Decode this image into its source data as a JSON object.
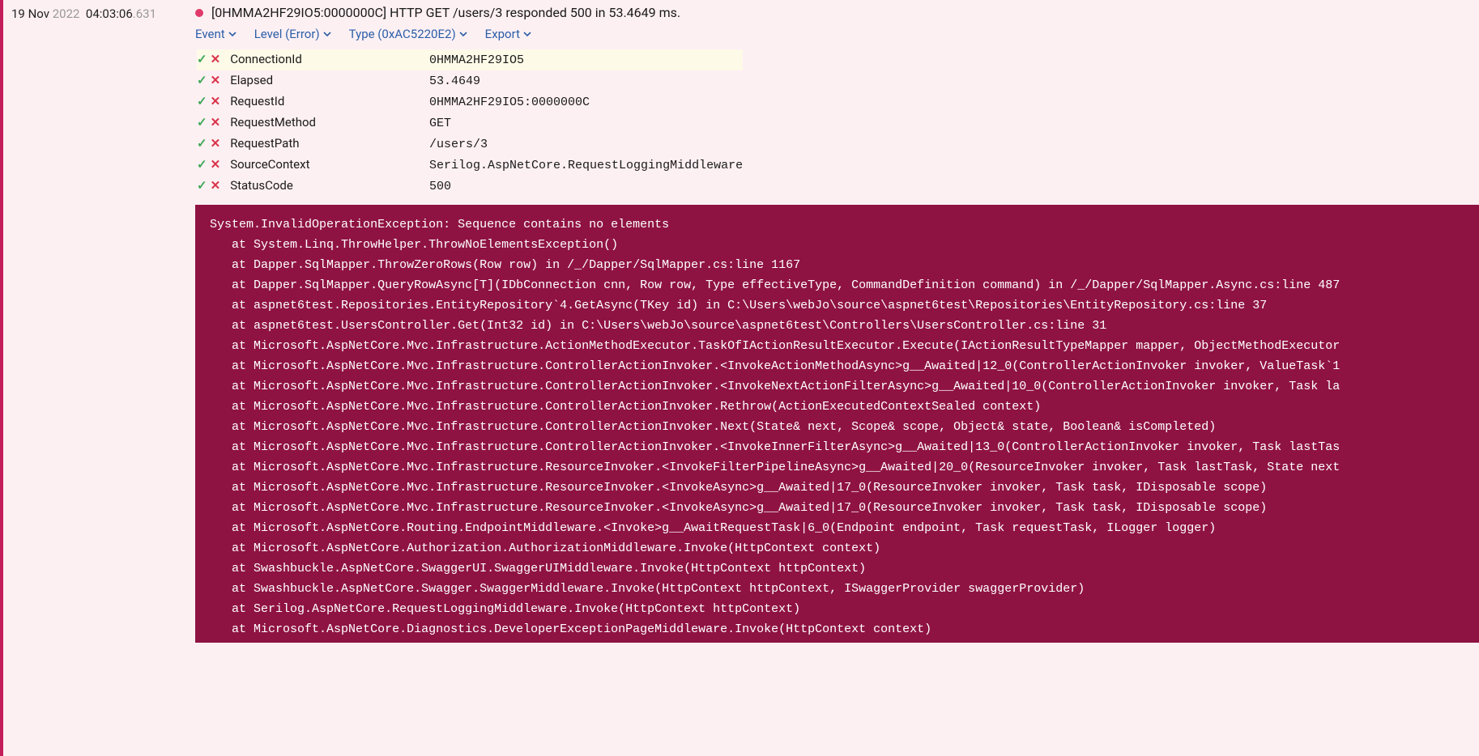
{
  "timestamp": {
    "date": "19 Nov",
    "year": "2022",
    "time": "04:03:06",
    "ms": ".631"
  },
  "colors": {
    "accent": "#c41e5a",
    "dot": "#e03a6a",
    "stack_bg": "#8f1342",
    "link": "#2b5ea8",
    "check": "#3ea856",
    "cross": "#d9334a",
    "highlight": "#fdfae8"
  },
  "log_message": "[0HMMA2HF29IO5:0000000C] HTTP GET /users/3 responded 500 in 53.4649 ms.",
  "filters": {
    "event": "Event",
    "level": "Level (Error)",
    "type": "Type (0xAC5220E2)",
    "export": "Export"
  },
  "properties": [
    {
      "key": "ConnectionId",
      "value": "0HMMA2HF29IO5",
      "highlight": true
    },
    {
      "key": "Elapsed",
      "value": "53.4649",
      "highlight": false
    },
    {
      "key": "RequestId",
      "value": "0HMMA2HF29IO5:0000000C",
      "highlight": false
    },
    {
      "key": "RequestMethod",
      "value": "GET",
      "highlight": false
    },
    {
      "key": "RequestPath",
      "value": "/users/3",
      "highlight": false
    },
    {
      "key": "SourceContext",
      "value": "Serilog.AspNetCore.RequestLoggingMiddleware",
      "highlight": false
    },
    {
      "key": "StatusCode",
      "value": "500",
      "highlight": false
    }
  ],
  "stacktrace": "System.InvalidOperationException: Sequence contains no elements\n   at System.Linq.ThrowHelper.ThrowNoElementsException()\n   at Dapper.SqlMapper.ThrowZeroRows(Row row) in /_/Dapper/SqlMapper.cs:line 1167\n   at Dapper.SqlMapper.QueryRowAsync[T](IDbConnection cnn, Row row, Type effectiveType, CommandDefinition command) in /_/Dapper/SqlMapper.Async.cs:line 487\n   at aspnet6test.Repositories.EntityRepository`4.GetAsync(TKey id) in C:\\Users\\webJo\\source\\aspnet6test\\Repositories\\EntityRepository.cs:line 37\n   at aspnet6test.UsersController.Get(Int32 id) in C:\\Users\\webJo\\source\\aspnet6test\\Controllers\\UsersController.cs:line 31\n   at Microsoft.AspNetCore.Mvc.Infrastructure.ActionMethodExecutor.TaskOfIActionResultExecutor.Execute(IActionResultTypeMapper mapper, ObjectMethodExecutor\n   at Microsoft.AspNetCore.Mvc.Infrastructure.ControllerActionInvoker.<InvokeActionMethodAsync>g__Awaited|12_0(ControllerActionInvoker invoker, ValueTask`1\n   at Microsoft.AspNetCore.Mvc.Infrastructure.ControllerActionInvoker.<InvokeNextActionFilterAsync>g__Awaited|10_0(ControllerActionInvoker invoker, Task la\n   at Microsoft.AspNetCore.Mvc.Infrastructure.ControllerActionInvoker.Rethrow(ActionExecutedContextSealed context)\n   at Microsoft.AspNetCore.Mvc.Infrastructure.ControllerActionInvoker.Next(State& next, Scope& scope, Object& state, Boolean& isCompleted)\n   at Microsoft.AspNetCore.Mvc.Infrastructure.ControllerActionInvoker.<InvokeInnerFilterAsync>g__Awaited|13_0(ControllerActionInvoker invoker, Task lastTas\n   at Microsoft.AspNetCore.Mvc.Infrastructure.ResourceInvoker.<InvokeFilterPipelineAsync>g__Awaited|20_0(ResourceInvoker invoker, Task lastTask, State next\n   at Microsoft.AspNetCore.Mvc.Infrastructure.ResourceInvoker.<InvokeAsync>g__Awaited|17_0(ResourceInvoker invoker, Task task, IDisposable scope)\n   at Microsoft.AspNetCore.Mvc.Infrastructure.ResourceInvoker.<InvokeAsync>g__Awaited|17_0(ResourceInvoker invoker, Task task, IDisposable scope)\n   at Microsoft.AspNetCore.Routing.EndpointMiddleware.<Invoke>g__AwaitRequestTask|6_0(Endpoint endpoint, Task requestTask, ILogger logger)\n   at Microsoft.AspNetCore.Authorization.AuthorizationMiddleware.Invoke(HttpContext context)\n   at Swashbuckle.AspNetCore.SwaggerUI.SwaggerUIMiddleware.Invoke(HttpContext httpContext)\n   at Swashbuckle.AspNetCore.Swagger.SwaggerMiddleware.Invoke(HttpContext httpContext, ISwaggerProvider swaggerProvider)\n   at Serilog.AspNetCore.RequestLoggingMiddleware.Invoke(HttpContext httpContext)\n   at Microsoft.AspNetCore.Diagnostics.DeveloperExceptionPageMiddleware.Invoke(HttpContext context)"
}
